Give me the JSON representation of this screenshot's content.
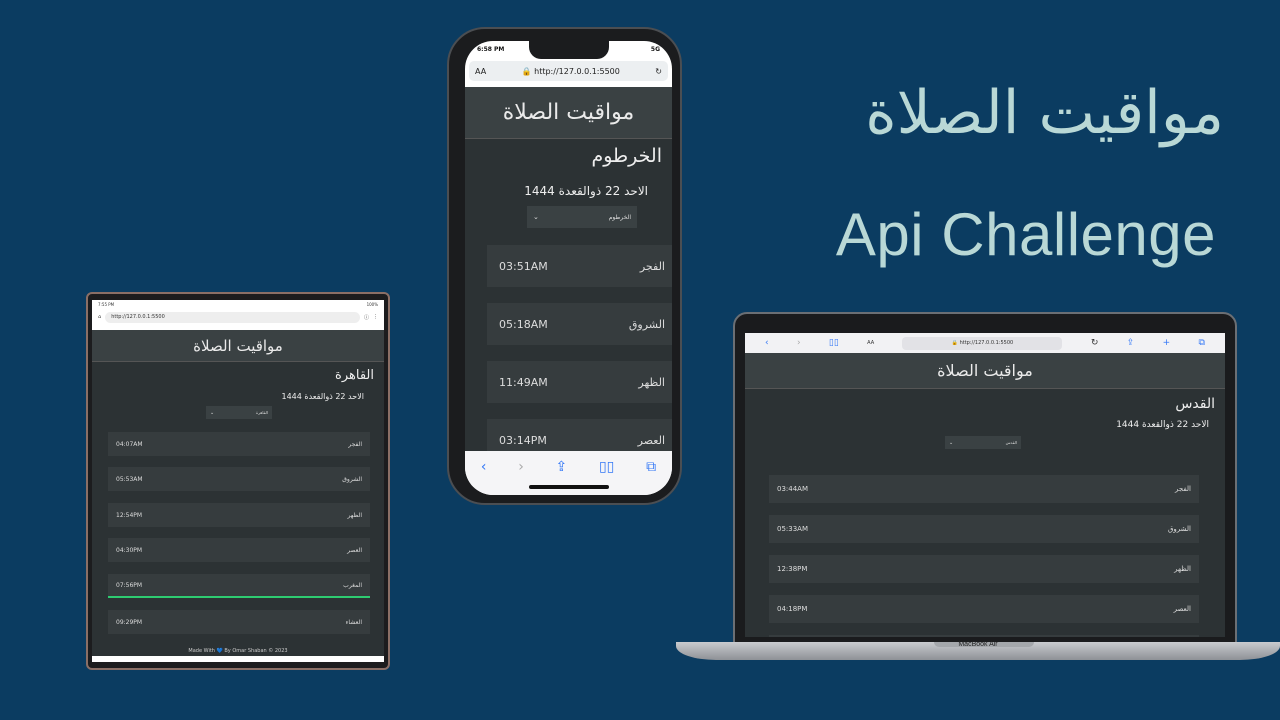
{
  "hero": {
    "title_ar": "مواقيت الصلاة",
    "title_en": "Api Challenge"
  },
  "app_title": "مواقيت الصلاة",
  "phone": {
    "time": "6:58 PM",
    "signal": "5G",
    "aa": "AA",
    "url": "http://127.0.0.1:5500",
    "city": "الخرطوم",
    "date": "الاحد 22 ذوالقعدة 1444",
    "selected_city": "الخرطوم",
    "prayers": [
      {
        "name": "الفجر",
        "time": "03:51AM"
      },
      {
        "name": "الشروق",
        "time": "05:18AM"
      },
      {
        "name": "الظهر",
        "time": "11:49AM"
      },
      {
        "name": "العصر",
        "time": "03:14PM"
      }
    ]
  },
  "tablet": {
    "time": "7:55 PM",
    "battery": "100%",
    "url": "http://127.0.0.1:5500",
    "city": "القاهرة",
    "date": "الاحد 22 ذوالقعدة 1444",
    "selected_city": "القاهرة",
    "prayers": [
      {
        "name": "الفجر",
        "time": "04:07AM"
      },
      {
        "name": "الشروق",
        "time": "05:53AM"
      },
      {
        "name": "الظهر",
        "time": "12:54PM"
      },
      {
        "name": "العصر",
        "time": "04:30PM"
      },
      {
        "name": "المغرب",
        "time": "07:56PM"
      },
      {
        "name": "العشاء",
        "time": "09:29PM"
      }
    ],
    "footer": "Made With 💙 By Omar Shaban © 2023"
  },
  "laptop": {
    "aa": "AA",
    "url": "http://127.0.0.1:5500",
    "city": "القدس",
    "date": "الاحد 22 ذوالقعدة 1444",
    "selected_city": "القدس",
    "prayers": [
      {
        "name": "الفجر",
        "time": "03:44AM"
      },
      {
        "name": "الشروق",
        "time": "05:33AM"
      },
      {
        "name": "الظهر",
        "time": "12:38PM"
      },
      {
        "name": "العصر",
        "time": "04:18PM"
      }
    ],
    "device_label": "MacBook Air"
  }
}
